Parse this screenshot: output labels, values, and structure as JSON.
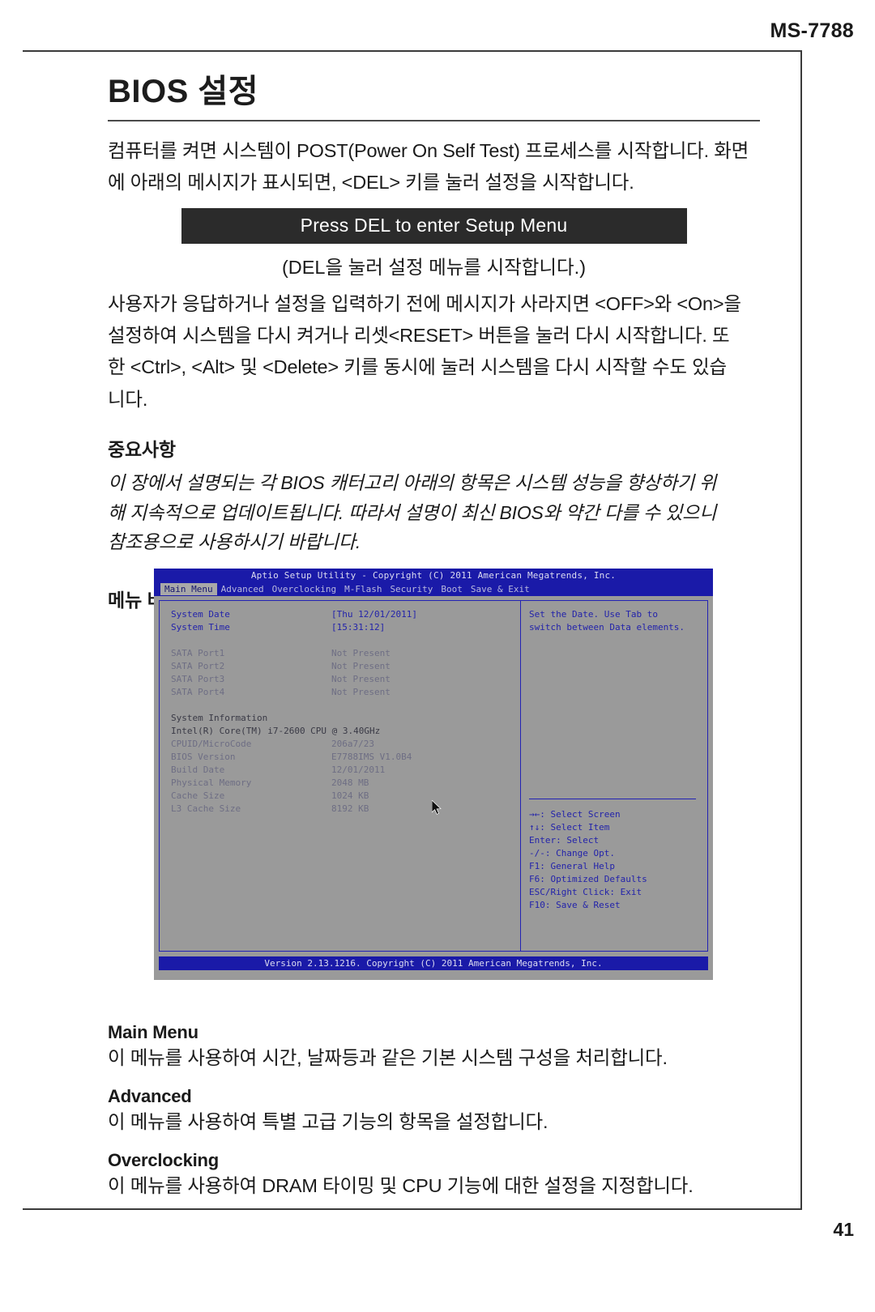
{
  "page": {
    "model_number": "MS-7788",
    "page_number": "41"
  },
  "chapter": {
    "title": "BIOS 설정",
    "intro_line1": "컴퓨터를 켜면 시스템이 POST(Power On Self Test) 프로세스를 시작합니다. 화면",
    "intro_line2": "에 아래의 메시지가 표시되면, <DEL> 키를 눌러 설정을 시작합니다.",
    "del_banner": "Press DEL to enter Setup Menu",
    "del_caption": "(DEL을 눌러 설정 메뉴를 시작합니다.)",
    "para2_line1": "사용자가 응답하거나 설정을 입력하기 전에 메시지가 사라지면 <OFF>와 <On>을",
    "para2_line2": "설정하여 시스템을 다시 켜거나 리셋<RESET> 버튼을 눌러 다시 시작합니다. 또",
    "para2_line3": "한 <Ctrl>, <Alt> 및  <Delete> 키를 동시에 눌러 시스템을 다시 시작할 수도 있습",
    "para2_line4": "니다."
  },
  "important": {
    "heading": "중요사항",
    "line1": "이 장에서 설명되는 각 BIOS 캐터고리 아래의 항목은 시스템 성능을 향상하기 위",
    "line2": "해 지속적으로 업데이트됩니다. 따라서 설명이 최신 BIOS와 약간 다를 수 있으니",
    "line3": "참조용으로 사용하시기 바랍니다."
  },
  "menubar": {
    "heading": "메뉴 바"
  },
  "bios": {
    "titlebar": "Aptio Setup Utility - Copyright (C) 2011 American Megatrends, Inc.",
    "footer": "Version 2.13.1216. Copyright (C) 2011 American Megatrends, Inc.",
    "tabs": [
      {
        "label": "Main Menu",
        "active": true
      },
      {
        "label": "Advanced",
        "active": false
      },
      {
        "label": "Overclocking",
        "active": false
      },
      {
        "label": "M-Flash",
        "active": false
      },
      {
        "label": "Security",
        "active": false
      },
      {
        "label": "Boot",
        "active": false
      },
      {
        "label": "Save & Exit",
        "active": false
      }
    ],
    "rows": {
      "system_date_label": "System Date",
      "system_date_value": "[Thu 12/01/2011]",
      "system_time_label": "System Time",
      "system_time_value": "[15:31:12]",
      "sata1_label": "SATA Port1",
      "sata1_value": "Not Present",
      "sata2_label": "SATA Port2",
      "sata2_value": "Not Present",
      "sata3_label": "SATA Port3",
      "sata3_value": "Not Present",
      "sata4_label": "SATA Port4",
      "sata4_value": "Not Present",
      "sysinfo_heading": "System Information",
      "cpu_name": "Intel(R) Core(TM) i7-2600 CPU @ 3.40GHz",
      "cpuid_label": "CPUID/MicroCode",
      "cpuid_value": "206a7/23",
      "bios_version_label": "BIOS Version",
      "bios_version_value": "E7788IMS V1.0B4",
      "build_date_label": "Build Date",
      "build_date_value": "12/01/2011",
      "physical_memory_label": "Physical Memory",
      "physical_memory_value": "2048 MB",
      "cache_size_label": "Cache Size",
      "cache_size_value": "1024 KB",
      "l3_cache_label": "L3 Cache Size",
      "l3_cache_value": "8192 KB"
    },
    "help": {
      "line1": "Set the Date. Use Tab to",
      "line2": "switch between Data elements."
    },
    "legend": [
      "→←: Select Screen",
      "↑↓: Select Item",
      "Enter: Select",
      "-/-: Change Opt.",
      "F1: General Help",
      "F6: Optimized Defaults",
      "ESC/Right Click: Exit",
      "F10: Save & Reset"
    ],
    "colors": {
      "header_blue": "#1a1aa8",
      "panel_gray": "#9a9a9a",
      "text_blue": "#2323aa",
      "border_blue": "#2222b4"
    }
  },
  "definitions": [
    {
      "heading": "Main Menu",
      "text": "이 메뉴를 사용하여 시간, 날짜등과 같은 기본 시스템 구성을 처리합니다."
    },
    {
      "heading": "Advanced",
      "text": "이 메뉴를 사용하여 특별 고급 기능의 항목을 설정합니다."
    },
    {
      "heading": "Overclocking",
      "text": "이 메뉴를 사용하여 DRAM 타이밍 및 CPU 기능에 대한 설정을 지정합니다."
    }
  ]
}
